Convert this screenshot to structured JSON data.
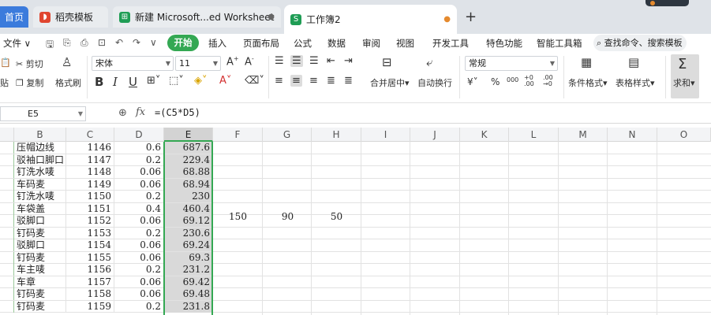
{
  "tabs": {
    "home": "首页",
    "template": "稻壳模板",
    "worksheet": "新建 Microsoft...ed Worksheet",
    "book2": "工作簿2",
    "new_tab": "+"
  },
  "menu": {
    "file": "文件",
    "items": [
      "开始",
      "插入",
      "页面布局",
      "公式",
      "数据",
      "审阅",
      "视图",
      "开发工具",
      "特色功能",
      "智能工具箱"
    ],
    "search": "查找命令、搜索模板"
  },
  "ribbon": {
    "cut": "剪切",
    "copy": "复制",
    "format_painter": "格式刷",
    "paste": "贴",
    "font_name": "宋体",
    "font_size": "11",
    "bold": "B",
    "italic": "I",
    "underline": "U",
    "merge_center": "合并居中",
    "wrap_text": "自动换行",
    "number_format": "常规",
    "currency": "¥",
    "percent": "%",
    "thousands": "000",
    "cond_format": "条件格式",
    "table_style": "表格样式",
    "sum": "求和"
  },
  "formula_bar": {
    "cell_ref": "E5",
    "fx": "fx",
    "formula": "=(C5*D5)"
  },
  "columns": [
    "B",
    "C",
    "D",
    "E",
    "F",
    "G",
    "H",
    "I",
    "J",
    "K",
    "L",
    "M",
    "N",
    "O"
  ],
  "rows": [
    {
      "b": "压帽边线",
      "c": "1146",
      "d": "0.6",
      "e": "687.6"
    },
    {
      "b": "驳袖口脚口",
      "c": "1147",
      "d": "0.2",
      "e": "229.4"
    },
    {
      "b": "钉洗水唛",
      "c": "1148",
      "d": "0.06",
      "e": "68.88"
    },
    {
      "b": "车码麦",
      "c": "1149",
      "d": "0.06",
      "e": "68.94"
    },
    {
      "b": "钉洗水唛",
      "c": "1150",
      "d": "0.2",
      "e": "230"
    },
    {
      "b": "车袋盖",
      "c": "1151",
      "d": "0.4",
      "e": "460.4"
    },
    {
      "b": "驳脚口",
      "c": "1152",
      "d": "0.06",
      "e": "69.12"
    },
    {
      "b": "钉码麦",
      "c": "1153",
      "d": "0.2",
      "e": "230.6"
    },
    {
      "b": "驳脚口",
      "c": "1154",
      "d": "0.06",
      "e": "69.24"
    },
    {
      "b": "钉码麦",
      "c": "1155",
      "d": "0.06",
      "e": "69.3"
    },
    {
      "b": "车主唛",
      "c": "1156",
      "d": "0.2",
      "e": "231.2"
    },
    {
      "b": "车章",
      "c": "1157",
      "d": "0.06",
      "e": "69.42"
    },
    {
      "b": "钉码麦",
      "c": "1158",
      "d": "0.06",
      "e": "69.48"
    },
    {
      "b": "钉码麦",
      "c": "1159",
      "d": "0.2",
      "e": "231.8"
    }
  ],
  "side_values": {
    "f": "150",
    "g": "90",
    "h": "50"
  }
}
